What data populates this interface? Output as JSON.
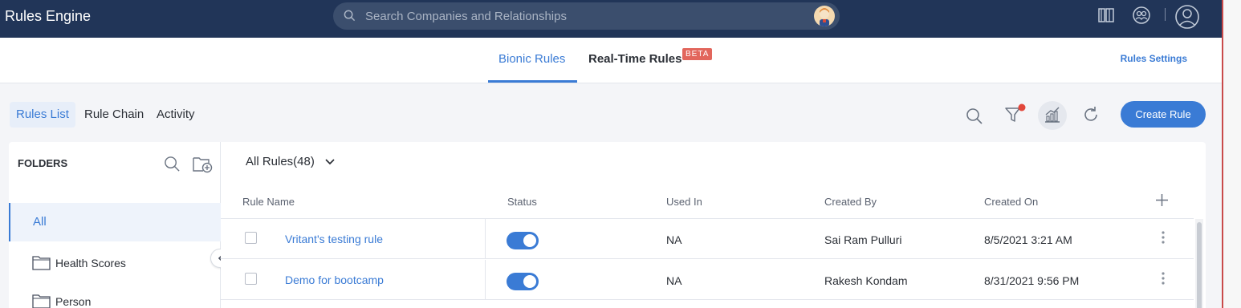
{
  "app": {
    "title": "Rules Engine"
  },
  "search": {
    "placeholder": "Search Companies and Relationships"
  },
  "topbar_icons": [
    "book-icon",
    "network-icon",
    "user-icon"
  ],
  "subnav": {
    "tabs": [
      {
        "label": "Bionic Rules",
        "active": true
      },
      {
        "label": "Real-Time Rules",
        "badge": "BETA"
      }
    ],
    "settings_label": "Rules Settings"
  },
  "subtabs": [
    {
      "label": "Rules List",
      "active": true
    },
    {
      "label": "Rule Chain"
    },
    {
      "label": "Activity"
    }
  ],
  "toolbar": {
    "icons": [
      "search-icon",
      "filter-icon",
      "analytics-icon",
      "refresh-icon"
    ],
    "create_label": "Create Rule"
  },
  "folders": {
    "title": "FOLDERS",
    "items": [
      {
        "label": "All",
        "active": true
      },
      {
        "label": "Health Scores"
      },
      {
        "label": "Person"
      }
    ]
  },
  "rules": {
    "header_label": "All Rules(48)",
    "columns": [
      "Rule Name",
      "Status",
      "Used In",
      "Created By",
      "Created On"
    ],
    "rows": [
      {
        "name": "Vritant's testing rule",
        "status_on": true,
        "used_in": "NA",
        "created_by": "Sai Ram Pulluri",
        "created_on": "8/5/2021 3:21 AM"
      },
      {
        "name": "Demo for bootcamp",
        "status_on": true,
        "used_in": "NA",
        "created_by": "Rakesh Kondam",
        "created_on": "8/31/2021 9:56 PM"
      }
    ]
  },
  "colors": {
    "nav_bg": "#213558",
    "accent": "#3a7bd5",
    "beta_badge": "#e2665c"
  }
}
